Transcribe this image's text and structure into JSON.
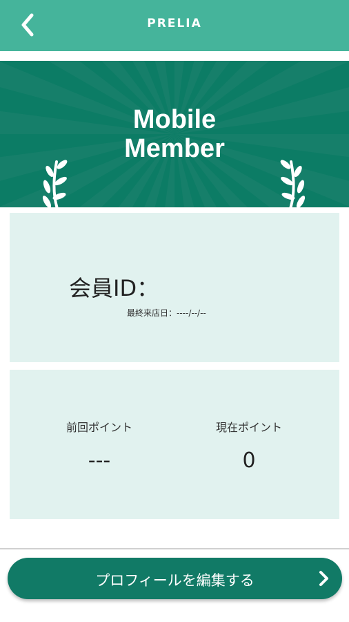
{
  "header": {
    "title": "PRELIA",
    "back_icon": "chevron-left-icon"
  },
  "banner": {
    "title_line1": "Mobile",
    "title_line2": "Member",
    "decor_icon": "laurel-icon"
  },
  "member": {
    "id_label": "会員ID：",
    "last_visit": "最終来店日：----/--/--"
  },
  "points": {
    "previous_label": "前回ポイント",
    "previous_value": "---",
    "current_label": "現在ポイント",
    "current_value": "0"
  },
  "footer": {
    "edit_profile_label": "プロフィールを編集する",
    "chevron_icon": "chevron-right-icon"
  },
  "colors": {
    "header": "#45b49b",
    "banner": "#0c7c65",
    "card": "#e1f2ef",
    "button": "#117a66"
  }
}
